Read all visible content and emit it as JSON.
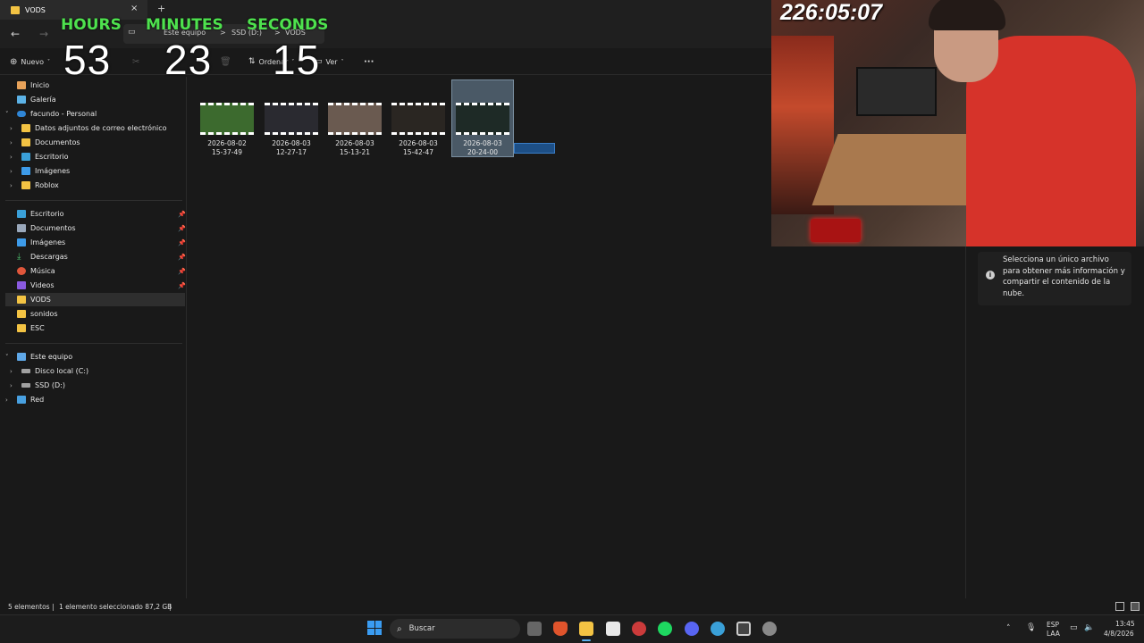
{
  "window": {
    "tab_title": "VODS",
    "new_tab": "+",
    "close": "×"
  },
  "address": {
    "crumbs": [
      "Este equipo",
      ">",
      "SSD (D:)",
      ">",
      "VODS"
    ]
  },
  "toolbar": {
    "new_label": "Nuevo",
    "sort_label": "Ordenar",
    "view_label": "Ver",
    "more_label": "···"
  },
  "timer": {
    "hours_label": "HOURS",
    "minutes_label": "MINUTES",
    "seconds_label": "SECONDS",
    "hours": "53",
    "minutes": "23",
    "seconds": "15"
  },
  "stream_time": "226:05:07",
  "sidebar": {
    "top": [
      {
        "label": "Inicio",
        "icon": "home-icon"
      },
      {
        "label": "Galería",
        "icon": "gallery-icon"
      },
      {
        "label": "facundo - Personal",
        "icon": "cloud-icon"
      },
      {
        "label": "Datos adjuntos de correo electrónico",
        "icon": "folder-icon"
      },
      {
        "label": "Documentos",
        "icon": "folder-icon"
      },
      {
        "label": "Escritorio",
        "icon": "desktop-icon"
      },
      {
        "label": "Imágenes",
        "icon": "pictures-icon"
      },
      {
        "label": "Roblox",
        "icon": "folder-icon"
      }
    ],
    "quick": [
      {
        "label": "Escritorio",
        "icon": "desktop-icon"
      },
      {
        "label": "Documentos",
        "icon": "documents-icon"
      },
      {
        "label": "Imágenes",
        "icon": "pictures-icon"
      },
      {
        "label": "Descargas",
        "icon": "downloads-icon"
      },
      {
        "label": "Música",
        "icon": "music-icon"
      },
      {
        "label": "Videos",
        "icon": "videos-icon"
      },
      {
        "label": "VODS",
        "icon": "folder-icon"
      },
      {
        "label": "sonidos",
        "icon": "folder-icon"
      },
      {
        "label": "ESC",
        "icon": "folder-icon"
      }
    ],
    "pc": [
      {
        "label": "Este equipo",
        "icon": "pc-icon"
      },
      {
        "label": "Disco local (C:)",
        "icon": "drive-icon"
      },
      {
        "label": "SSD (D:)",
        "icon": "drive-icon"
      },
      {
        "label": "Red",
        "icon": "network-icon"
      }
    ]
  },
  "files": [
    {
      "line1": "2026-08-02",
      "line2": "15-37-49",
      "color": "#3c6a2e"
    },
    {
      "line1": "2026-08-03",
      "line2": "12-27-17",
      "color": "#2a2a30"
    },
    {
      "line1": "2026-08-03",
      "line2": "15-13-21",
      "color": "#6a5a50"
    },
    {
      "line1": "2026-08-03",
      "line2": "15-42-47",
      "color": "#2a2622"
    },
    {
      "line1": "2026-08-03",
      "line2": "20-24-00",
      "color": "#1e2a26"
    }
  ],
  "details": {
    "info": "Selecciona un único archivo para obtener más información y compartir el contenido de la nube."
  },
  "status": {
    "count": "5 elementos",
    "sep": "|",
    "selection": "1 elemento seleccionado  87,2 GB"
  },
  "taskbar": {
    "search": "Buscar",
    "lang1": "ESP",
    "lang2": "LAA",
    "time": "13:45",
    "date": "4/8/2026"
  }
}
